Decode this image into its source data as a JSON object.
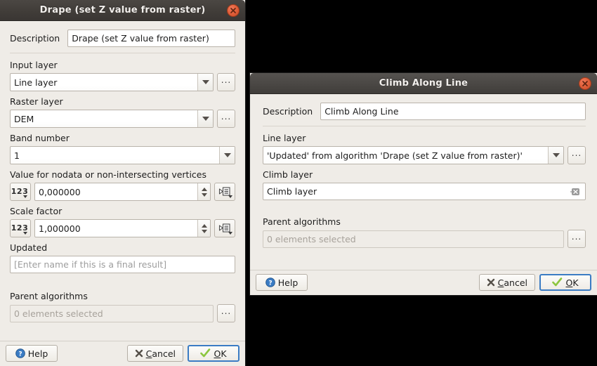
{
  "drape_dialog": {
    "title": "Drape (set Z value from raster)",
    "close_icon": "close-icon",
    "description": {
      "label": "Description",
      "value": "Drape (set Z value from raster)"
    },
    "input_layer": {
      "label": "Input layer",
      "value": "Line layer",
      "browse_label": "...",
      "dropdown_icon": "chevron-down-icon"
    },
    "raster_layer": {
      "label": "Raster layer",
      "value": "DEM",
      "browse_label": "...",
      "dropdown_icon": "chevron-down-icon"
    },
    "band_number": {
      "label": "Band number",
      "value": "1",
      "dropdown_icon": "chevron-down-icon"
    },
    "nodata_value": {
      "label": "Value for nodata or non-intersecting vertices",
      "value": "0,000000",
      "type_button_label": "123",
      "data_defined_icon": "data-defined-override-icon"
    },
    "scale_factor": {
      "label": "Scale factor",
      "value": "1,000000",
      "type_button_label": "123",
      "data_defined_icon": "data-defined-override-icon"
    },
    "updated": {
      "label": "Updated",
      "value": "",
      "placeholder": "[Enter name if this is a final result]"
    },
    "parent_algorithms": {
      "label": "Parent algorithms",
      "value": "0 elements selected",
      "browse_label": "..."
    },
    "footer": {
      "help_label": "Help",
      "help_icon": "help-circle-icon",
      "cancel_label_pre": "",
      "cancel_underlined": "C",
      "cancel_label_post": "ancel",
      "cancel_icon": "close-x-icon",
      "ok_underlined": "O",
      "ok_label_post": "K",
      "ok_icon": "check-icon"
    }
  },
  "climb_dialog": {
    "title": "Climb Along Line",
    "close_icon": "close-icon",
    "description": {
      "label": "Description",
      "value": "Climb Along Line"
    },
    "line_layer": {
      "label": "Line layer",
      "value": "'Updated' from algorithm 'Drape (set Z value from raster)'",
      "browse_label": "...",
      "dropdown_icon": "chevron-down-icon"
    },
    "climb_layer": {
      "label": "Climb layer",
      "value": "Climb layer",
      "clear_icon": "clear-x-icon"
    },
    "parent_algorithms": {
      "label": "Parent algorithms",
      "value": "0 elements selected",
      "browse_label": "..."
    },
    "footer": {
      "help_label": "Help",
      "help_icon": "help-circle-icon",
      "cancel_underlined": "C",
      "cancel_label_post": "ancel",
      "cancel_icon": "close-x-icon",
      "ok_underlined": "O",
      "ok_label_post": "K",
      "ok_icon": "check-icon"
    }
  },
  "colors": {
    "dialog_bg": "#efece7",
    "titlebar_inactive": "#413d39",
    "titlebar_active": "#4a4744",
    "close_button": "#e2613c",
    "focus_border": "#3b7cc4",
    "ok_check": "#8cc63f",
    "help_blue": "#3b7cc4",
    "text": "#1d1d1d",
    "placeholder_text": "#9d9d9d",
    "desktop": "#000000"
  }
}
